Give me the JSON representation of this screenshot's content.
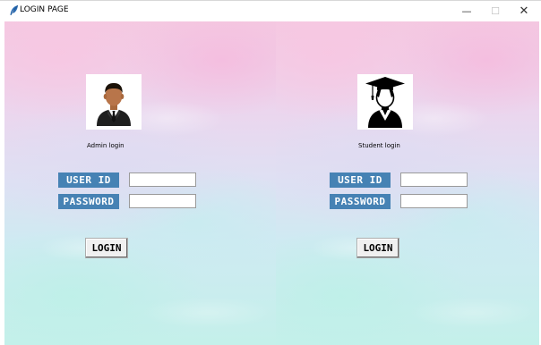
{
  "window": {
    "title": "LOGIN PAGE",
    "controls": {
      "minimize": "—",
      "maximize": "☐",
      "close": "✕"
    }
  },
  "admin_panel": {
    "caption": "Admin login",
    "avatar_icon": "businessman-icon",
    "user_id_label": "USER ID",
    "password_label": "PASSWORD",
    "user_id_value": "",
    "password_value": "",
    "login_label": "LOGIN"
  },
  "student_panel": {
    "caption": "Student login",
    "avatar_icon": "graduate-icon",
    "user_id_label": "USER ID",
    "password_label": "PASSWORD",
    "user_id_value": "",
    "password_value": "",
    "login_label": "LOGIN"
  },
  "colors": {
    "label_background": "#4682b4",
    "label_text": "#ffffff",
    "button_face": "#f0f0f0"
  }
}
